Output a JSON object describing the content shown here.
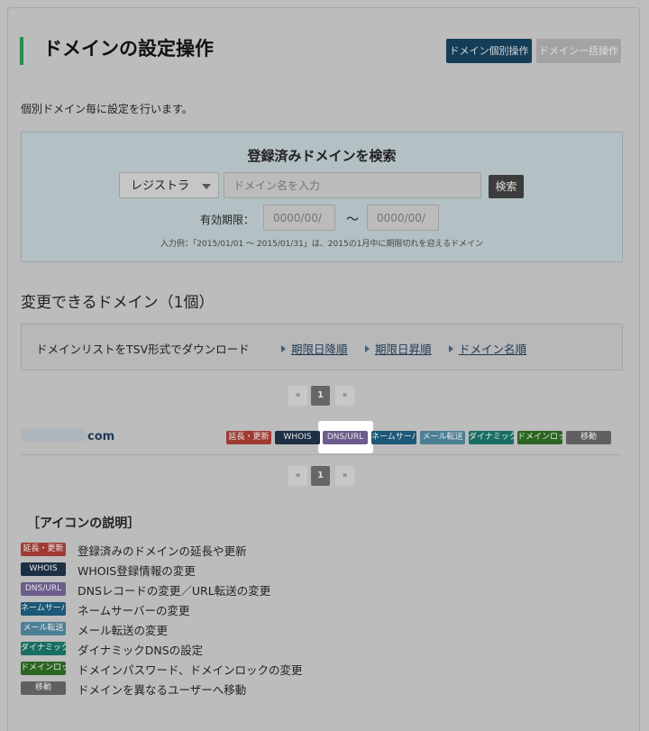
{
  "page": {
    "title": "ドメインの設定操作",
    "intro": "個別ドメイン毎に設定を行います。"
  },
  "top_buttons": {
    "single": "ドメイン個別操作",
    "bulk": "ドメイン一括操作"
  },
  "search": {
    "title": "登録済みドメインを検索",
    "registrar_selected": "レジストラ",
    "domain_placeholder": "ドメイン名を入力",
    "search_button": "検索",
    "expiry_label": "有効期限：",
    "date_placeholder": "0000/00/",
    "tilde": "〜",
    "example": "入力例：「2015/01/01 〜 2015/01/31」は、2015の1月中に期限切れを迎えるドメイン"
  },
  "list": {
    "heading": "変更できるドメイン（1個）",
    "tsv_label": "ドメインリストをTSV形式でダウンロード",
    "sort_links": [
      "期限日降順",
      "期限日昇順",
      "ドメイン名順"
    ]
  },
  "pagination": {
    "prev": "«",
    "current": "1",
    "next": "»"
  },
  "domain_row": {
    "suffix": "com",
    "actions": [
      {
        "label": "延長・更新",
        "color": "#9f3b33"
      },
      {
        "label": "WHOIS",
        "color": "#1c2f45"
      },
      {
        "label": "DNS/URL",
        "color": "#6b5d8c"
      },
      {
        "label": "ネームサーバー",
        "color": "#1c5877"
      },
      {
        "label": "メール転送",
        "color": "#4c7f96"
      },
      {
        "label": "ダイナミック",
        "color": "#186e62"
      },
      {
        "label": "ドメインロック",
        "color": "#2b6621"
      },
      {
        "label": "移動",
        "color": "#606060"
      }
    ]
  },
  "legend": {
    "title": "［アイコンの説明］",
    "items": [
      {
        "badge": "延長・更新",
        "text": "登録済みのドメインの延長や更新",
        "color": "#9f3b33"
      },
      {
        "badge": "WHOIS",
        "text": "WHOIS登録情報の変更",
        "color": "#1c2f45"
      },
      {
        "badge": "DNS/URL",
        "text": "DNSレコードの変更／URL転送の変更",
        "color": "#6b5d8c"
      },
      {
        "badge": "ネームサーバー",
        "text": "ネームサーバーの変更",
        "color": "#1c5877"
      },
      {
        "badge": "メール転送",
        "text": "メール転送の変更",
        "color": "#4c7f96"
      },
      {
        "badge": "ダイナミック",
        "text": "ダイナミックDNSの設定",
        "color": "#186e62"
      },
      {
        "badge": "ドメインロック",
        "text": "ドメインパスワード、ドメインロックの変更",
        "color": "#2b6621"
      },
      {
        "badge": "移動",
        "text": "ドメインを異なるユーザーへ移動",
        "color": "#606060"
      }
    ]
  }
}
